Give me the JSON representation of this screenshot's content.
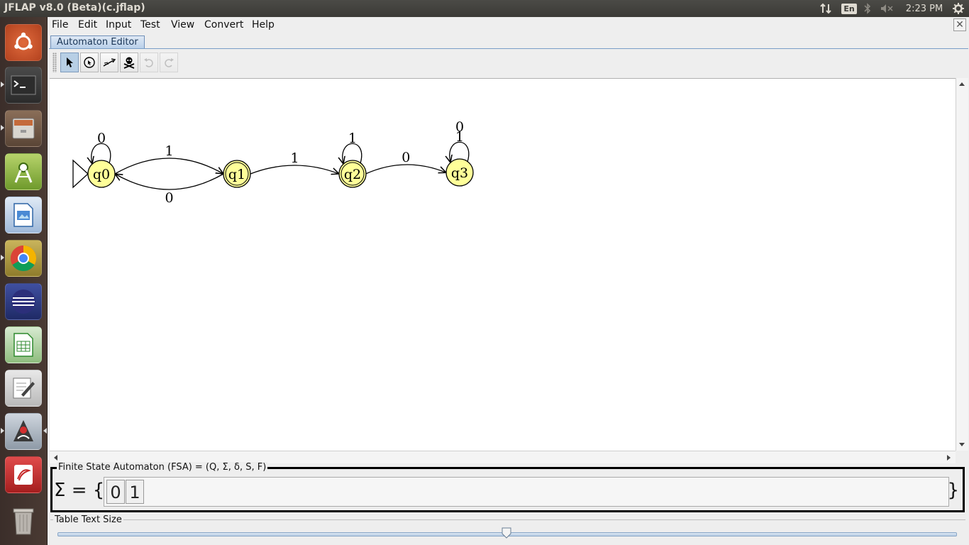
{
  "window": {
    "title": "JFLAP v8.0 (Beta)(c.jflap)"
  },
  "tray": {
    "lang": "En",
    "clock": "2:23 PM"
  },
  "menubar": {
    "items": [
      "File",
      "Edit",
      "Input",
      "Test",
      "View",
      "Convert",
      "Help"
    ]
  },
  "tabs": [
    {
      "label": "Automaton Editor"
    }
  ],
  "toolbar": {
    "tools": [
      "attribute-editor",
      "state-creator",
      "transition-creator",
      "deleter",
      "undo",
      "redo"
    ]
  },
  "automaton": {
    "states": [
      {
        "id": "q0",
        "initial": true,
        "final": false
      },
      {
        "id": "q1",
        "initial": false,
        "final": true
      },
      {
        "id": "q2",
        "initial": false,
        "final": true
      },
      {
        "id": "q3",
        "initial": false,
        "final": false
      }
    ],
    "transitions": [
      {
        "from": "q0",
        "to": "q0",
        "symbol": "0"
      },
      {
        "from": "q0",
        "to": "q1",
        "symbol": "1"
      },
      {
        "from": "q1",
        "to": "q0",
        "symbol": "0"
      },
      {
        "from": "q1",
        "to": "q2",
        "symbol": "1"
      },
      {
        "from": "q2",
        "to": "q2",
        "symbol": "1"
      },
      {
        "from": "q2",
        "to": "q3",
        "symbol": "0"
      },
      {
        "from": "q3",
        "to": "q3",
        "symbol": "1"
      },
      {
        "from": "q3",
        "to": "q3",
        "symbol": "0"
      }
    ]
  },
  "fsa_panel": {
    "title": "Finite State Automaton (FSA) = (Q, Σ, δ, S, F)",
    "sigma_label": "Σ = {",
    "brace_close": "}",
    "alphabet": [
      "0",
      "1"
    ]
  },
  "size_panel": {
    "title": "Table Text Size",
    "slider_value": 0.5
  },
  "colors": {
    "state_fill": "#ffff99",
    "panel_bg": "#eeeeee",
    "tab_fill": "#b9d0ea"
  }
}
